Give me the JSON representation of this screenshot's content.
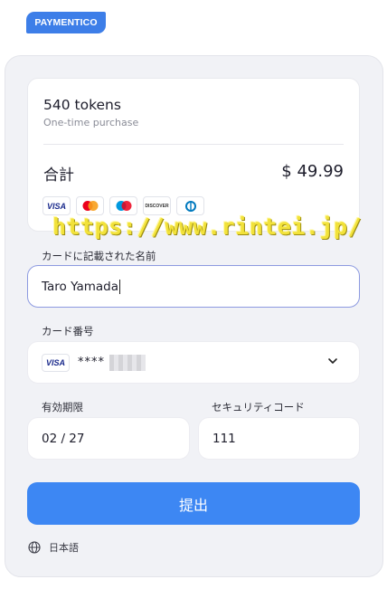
{
  "brand": {
    "logo_text": "PAYMENTICO"
  },
  "summary": {
    "product": "540 tokens",
    "purchase_type": "One-time purchase",
    "total_label": "合計",
    "total_amount": "$ 49.99",
    "card_brands": [
      "visa",
      "mastercard",
      "maestro",
      "discover",
      "diners"
    ],
    "visa_text": "VISA",
    "discover_text": "DISCOVER"
  },
  "watermark": "https://www.rintei.jp/",
  "form": {
    "name_label": "カードに記載された名前",
    "name_value": "Taro Yamada",
    "card_label": "カード番号",
    "card_brand_text": "VISA",
    "card_masked": "****",
    "expiry_label": "有効期限",
    "expiry_value": "02 / 27",
    "cvc_label": "セキュリティコード",
    "cvc_value": "111"
  },
  "submit_label": "提出",
  "language": {
    "label": "日本語",
    "icon": "globe-icon"
  },
  "colors": {
    "accent": "#3d87f3",
    "brand": "#3d7ee8",
    "panel": "#f1f2f6"
  }
}
